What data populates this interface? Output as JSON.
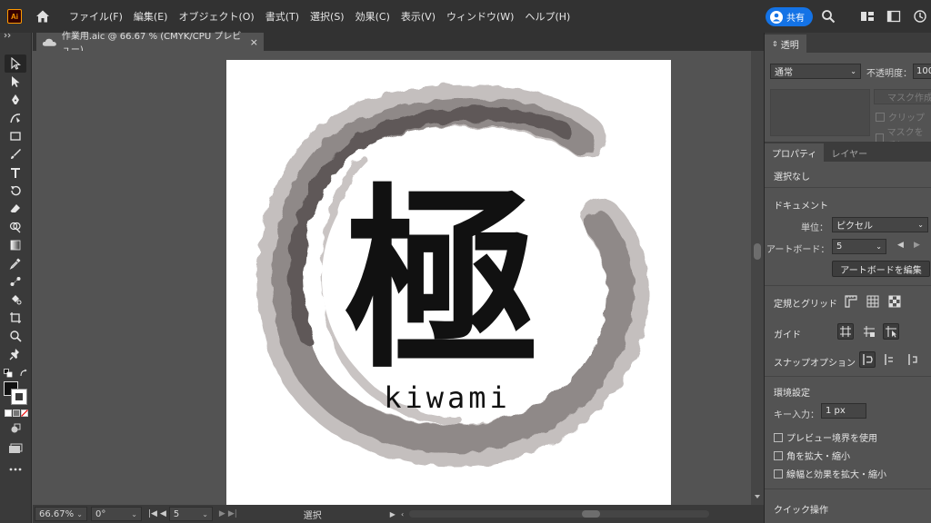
{
  "app": {
    "logo_text": "Ai"
  },
  "menu": {
    "items": [
      "ファイル(F)",
      "編集(E)",
      "オブジェクト(O)",
      "書式(T)",
      "選択(S)",
      "効果(C)",
      "表示(V)",
      "ウィンドウ(W)",
      "ヘルプ(H)"
    ],
    "share_label": "共有"
  },
  "document": {
    "tab_title": "作業用.aic @ 66.67 % (CMYK/CPU プレビュー)",
    "close_glyph": "×"
  },
  "artwork": {
    "kanji": "極",
    "romaji": "kiwami"
  },
  "statusbar": {
    "zoom": "66.67%",
    "rotation": "0°",
    "artboard_number": "5",
    "tool_name": "選択"
  },
  "transparency_panel": {
    "tab_label": "透明",
    "blend_mode": "通常",
    "opacity_label": "不透明度：",
    "opacity_value": "100",
    "mask_button": "マスク作成",
    "clip_label": "クリップ",
    "invert_mask_label": "マスクを反転"
  },
  "properties_panel": {
    "tabs": [
      "プロパティ",
      "レイヤー"
    ],
    "selection_status": "選択なし",
    "document_title": "ドキュメント",
    "unit_label": "単位：",
    "unit_value": "ピクセル",
    "artboard_label": "アートボード：",
    "artboard_value": "5",
    "edit_artboards_button": "アートボードを編集",
    "rulers_grid_label": "定規とグリッド",
    "guides_label": "ガイド",
    "snap_options_label": "スナップオプション",
    "preferences_title": "環境設定",
    "key_increment_label": "キー入力：",
    "key_increment_value": "1 px",
    "use_preview_bounds_label": "プレビュー境界を使用",
    "scale_corners_label": "角を拡大・縮小",
    "scale_strokes_label": "線幅と効果を拡大・縮小",
    "quick_actions_title": "クイック操作"
  },
  "colors": {
    "app_bg": "#535353",
    "menubar_bg": "#323232",
    "share_blue": "#1473e6",
    "ai_orange": "#ff9a00",
    "ink": "#111111",
    "brush_gray": "#8a8584"
  }
}
